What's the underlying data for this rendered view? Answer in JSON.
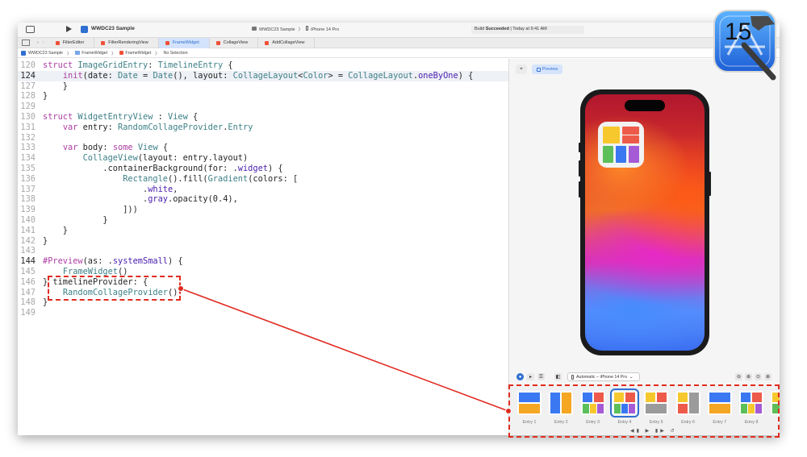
{
  "window": {
    "title": "WWDC23 Sample",
    "scheme_path": "WWDC23 Sample",
    "run_destination": "iPhone 14 Pro",
    "build_status_prefix": "Build",
    "build_status_bold": "Succeeded",
    "build_status_suffix": "| Today at 9:41 AM"
  },
  "tabs": [
    {
      "label": "FilterEditor",
      "active": false
    },
    {
      "label": "FilterRenderingView",
      "active": false
    },
    {
      "label": "FrameWidget",
      "active": true
    },
    {
      "label": "CollageView",
      "active": false
    },
    {
      "label": "AddCollageView",
      "active": false
    }
  ],
  "breadcrumb": [
    "WWDC23 Sample",
    "FrameWidget",
    "FrameWidget",
    "No Selection"
  ],
  "code_lines": [
    {
      "n": "120",
      "text": "struct ImageGridEntry: TimelineEntry {",
      "cur": false
    },
    {
      "n": "124",
      "text": "    init(date: Date = Date(), layout: CollageLayout<Color> = CollageLayout.oneByOne) {",
      "cur": true
    },
    {
      "n": "127",
      "text": "    }",
      "cur": false
    },
    {
      "n": "128",
      "text": "}",
      "cur": false
    },
    {
      "n": "129",
      "text": "",
      "cur": false
    },
    {
      "n": "130",
      "text": "struct WidgetEntryView : View {",
      "cur": false
    },
    {
      "n": "131",
      "text": "    var entry: RandomCollageProvider.Entry",
      "cur": false
    },
    {
      "n": "132",
      "text": "",
      "cur": false
    },
    {
      "n": "133",
      "text": "    var body: some View {",
      "cur": false
    },
    {
      "n": "134",
      "text": "        CollageView(layout: entry.layout)",
      "cur": false
    },
    {
      "n": "135",
      "text": "            .containerBackground(for: .widget) {",
      "cur": false
    },
    {
      "n": "136",
      "text": "                Rectangle().fill(Gradient(colors: [",
      "cur": false
    },
    {
      "n": "137",
      "text": "                    .white,",
      "cur": false
    },
    {
      "n": "138",
      "text": "                    .gray.opacity(0.4),",
      "cur": false
    },
    {
      "n": "139",
      "text": "                ]))",
      "cur": false
    },
    {
      "n": "140",
      "text": "            }",
      "cur": false
    },
    {
      "n": "141",
      "text": "    }",
      "cur": false
    },
    {
      "n": "142",
      "text": "}",
      "cur": false
    },
    {
      "n": "143",
      "text": "",
      "cur": false
    },
    {
      "n": "144",
      "text": "#Preview(as: .systemSmall) {",
      "cur": true
    },
    {
      "n": "145",
      "text": "    FrameWidget()",
      "cur": false
    },
    {
      "n": "146",
      "text": "} timelineProvider: {",
      "cur": false
    },
    {
      "n": "147",
      "text": "    RandomCollageProvider()",
      "cur": false
    },
    {
      "n": "148",
      "text": "}",
      "cur": false
    },
    {
      "n": "149",
      "text": "",
      "cur": false
    }
  ],
  "canvas": {
    "preview_label": "Preview",
    "device_selector": "Automatic – iPhone 14 Pro"
  },
  "timeline_entries": [
    {
      "label": "Entry 1",
      "selected": false,
      "layout": "oneByTwo-h"
    },
    {
      "label": "Entry 2",
      "selected": false,
      "layout": "twoByOne-v"
    },
    {
      "label": "Entry 3",
      "selected": false,
      "layout": "grid-2-3"
    },
    {
      "label": "Entry 4",
      "selected": true,
      "layout": "grid-2-3"
    },
    {
      "label": "Entry 5",
      "selected": false,
      "layout": "grid-2-1"
    },
    {
      "label": "Entry 6",
      "selected": false,
      "layout": "split-v"
    },
    {
      "label": "Entry 7",
      "selected": false,
      "layout": "oneByTwo-h"
    },
    {
      "label": "Entry 8",
      "selected": false,
      "layout": "grid-2-3"
    },
    {
      "label": "E",
      "selected": false,
      "layout": "partial"
    }
  ],
  "badge": {
    "version": "15"
  },
  "colors": {
    "accent": "#2f6fd1",
    "annotation_red": "#e02b20",
    "keyword": "#ad3da4",
    "type": "#3e8087",
    "tile_blue": "#3a78f2",
    "tile_yellow": "#f7c82e",
    "tile_orange": "#f5a623",
    "tile_red": "#ee5a49",
    "tile_green": "#5cbf5a",
    "tile_purple": "#a55ad6",
    "tile_gray": "#9b9b9b"
  }
}
